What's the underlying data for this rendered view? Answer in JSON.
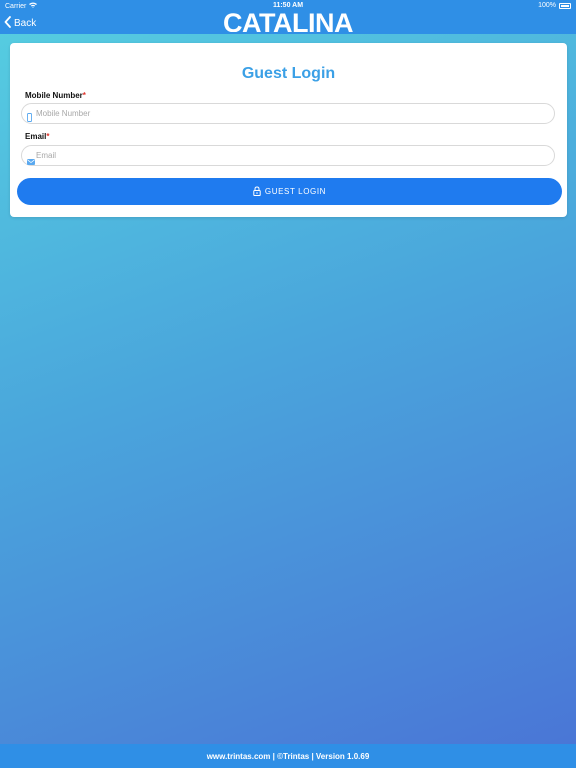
{
  "status_bar": {
    "carrier": "Carrier",
    "time": "11:50 AM",
    "battery": "100%",
    "icons": [
      "wifi-icon",
      "battery-icon"
    ]
  },
  "nav": {
    "back_label": "Back",
    "logo_text": "CATALINA",
    "icon": "chevron-left-icon"
  },
  "form": {
    "title": "Guest Login",
    "mobile": {
      "label": "Mobile Number",
      "required_mark": "*",
      "placeholder": "Mobile Number",
      "value": "",
      "icon": "phone-icon"
    },
    "email": {
      "label": "Email",
      "required_mark": "*",
      "placeholder": "Email",
      "value": "",
      "icon": "email-icon"
    },
    "submit_label": "GUEST LOGIN",
    "submit_icon": "lock-icon"
  },
  "footer": {
    "text": "www.trintas.com | ©Trintas | Version 1.0.69"
  },
  "colors": {
    "brand": "#2f8fe6",
    "button": "#1f7bef",
    "title": "#3ba0e6",
    "required": "#e0342b"
  }
}
